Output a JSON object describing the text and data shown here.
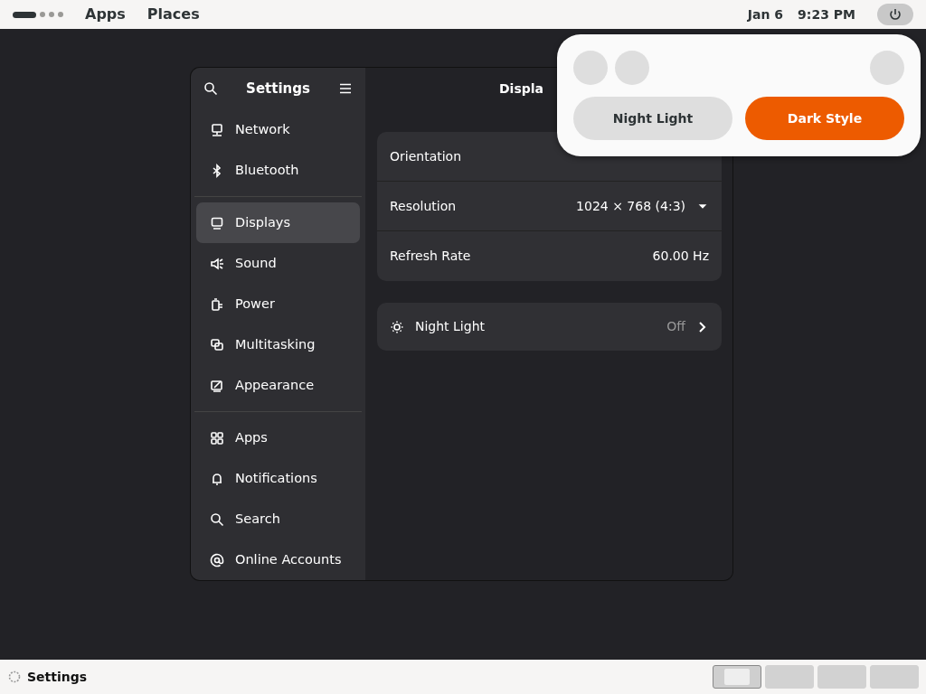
{
  "top_bar": {
    "workspaces": [
      {
        "selected": true
      },
      {
        "selected": false
      },
      {
        "selected": false
      },
      {
        "selected": false
      }
    ],
    "menus": [
      "Apps",
      "Places"
    ],
    "date": "Jan 6",
    "time": "9:23 PM"
  },
  "window": {
    "sidebar": {
      "title": "Settings",
      "groups": [
        [
          {
            "label": "Network",
            "selected": false
          },
          {
            "label": "Bluetooth",
            "selected": false
          }
        ],
        [
          {
            "label": "Displays",
            "selected": true
          },
          {
            "label": "Sound",
            "selected": false
          },
          {
            "label": "Power",
            "selected": false
          },
          {
            "label": "Multitasking",
            "selected": false
          },
          {
            "label": "Appearance",
            "selected": false
          }
        ],
        [
          {
            "label": "Apps",
            "selected": false
          },
          {
            "label": "Notifications",
            "selected": false
          },
          {
            "label": "Search",
            "selected": false
          },
          {
            "label": "Online Accounts",
            "selected": false
          }
        ]
      ]
    },
    "title": "Displa",
    "groups": [
      [
        {
          "kind": "plain",
          "label": "Orientation"
        },
        {
          "kind": "combo",
          "label": "Resolution",
          "value": "1024 × 768 (4:3)"
        },
        {
          "kind": "value",
          "label": "Refresh Rate",
          "value": "60.00 Hz"
        }
      ],
      [
        {
          "kind": "link",
          "label": "Night Light",
          "value": "Off"
        }
      ]
    ]
  },
  "quick_settings": {
    "toggles": [
      {
        "label": "Night Light",
        "on": false
      },
      {
        "label": "Dark Style",
        "on": true
      }
    ]
  },
  "taskbar": {
    "app": "Settings",
    "workspaces": [
      {
        "selected": true
      },
      {
        "selected": false
      },
      {
        "selected": false
      },
      {
        "selected": false
      }
    ]
  }
}
